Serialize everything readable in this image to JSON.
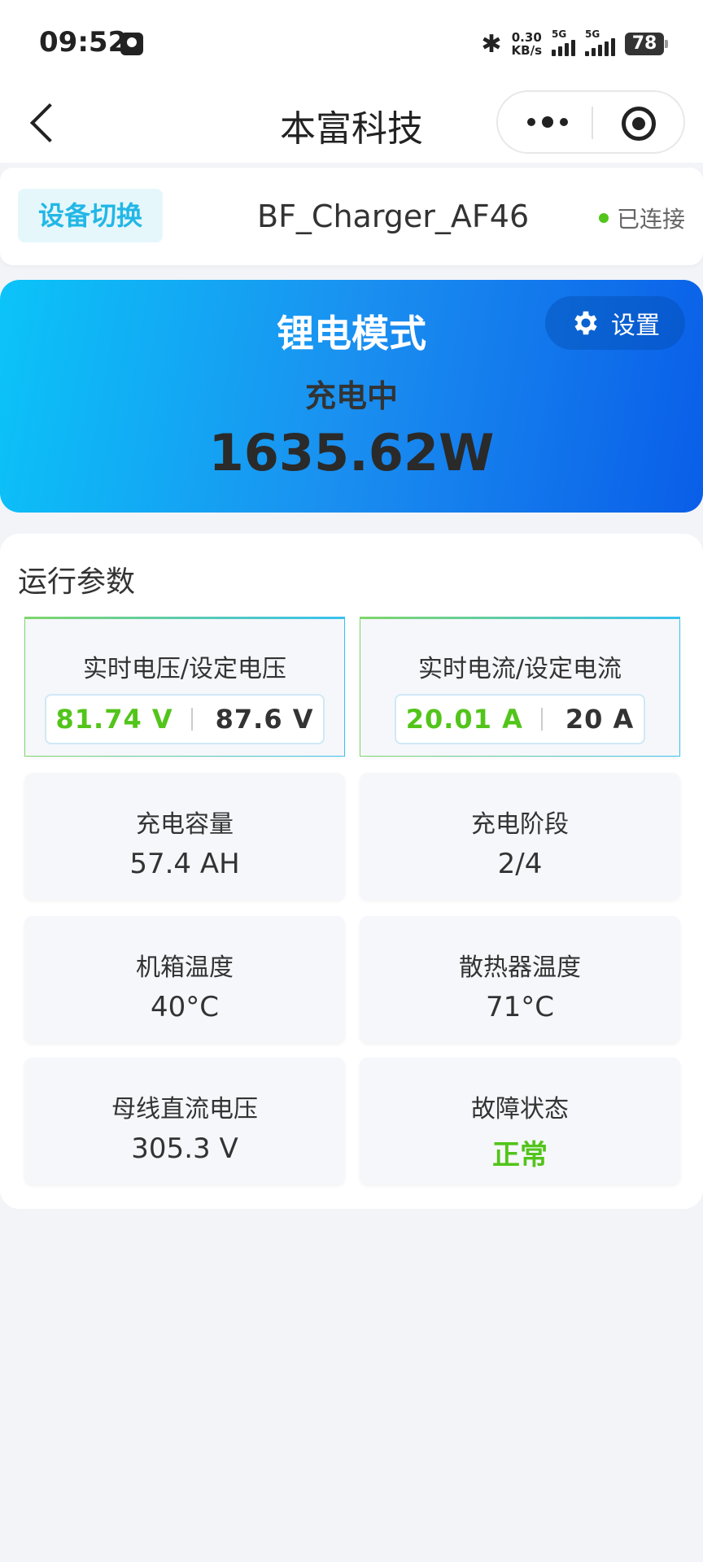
{
  "status_bar": {
    "time": "09:52",
    "bluetooth_icon": "bluetooth-icon",
    "net_speed_value": "0.30",
    "net_speed_unit": "KB/s",
    "signal1_label": "5G",
    "signal2_label": "5G",
    "battery": "78"
  },
  "nav": {
    "title": "本富科技"
  },
  "device": {
    "switch_label": "设备切换",
    "name": "BF_Charger_AF46",
    "status": "已连接",
    "status_color": "#52c41a"
  },
  "hero": {
    "mode": "锂电模式",
    "state": "充电中",
    "power": "1635.62W",
    "settings_label": "设置"
  },
  "params": {
    "title": "运行参数",
    "voltage": {
      "label": "实时电压/设定电压",
      "live": "81.74 V",
      "set": "87.6 V"
    },
    "current": {
      "label": "实时电流/设定电流",
      "live": "20.01 A",
      "set": "20 A"
    },
    "tiles": [
      {
        "label": "充电容量",
        "value": "57.4 AH"
      },
      {
        "label": "充电阶段",
        "value": "2/4"
      },
      {
        "label": "机箱温度",
        "value": "40°C"
      },
      {
        "label": "散热器温度",
        "value": "71°C"
      },
      {
        "label": "母线直流电压",
        "value": "305.3 V"
      },
      {
        "label": "故障状态",
        "value": "正常"
      }
    ]
  },
  "colors": {
    "accent": "#22b7e6",
    "ok_green": "#52c41a",
    "hero_gradient_start": "#0bc4f8",
    "hero_gradient_end": "#0a5ee8"
  }
}
